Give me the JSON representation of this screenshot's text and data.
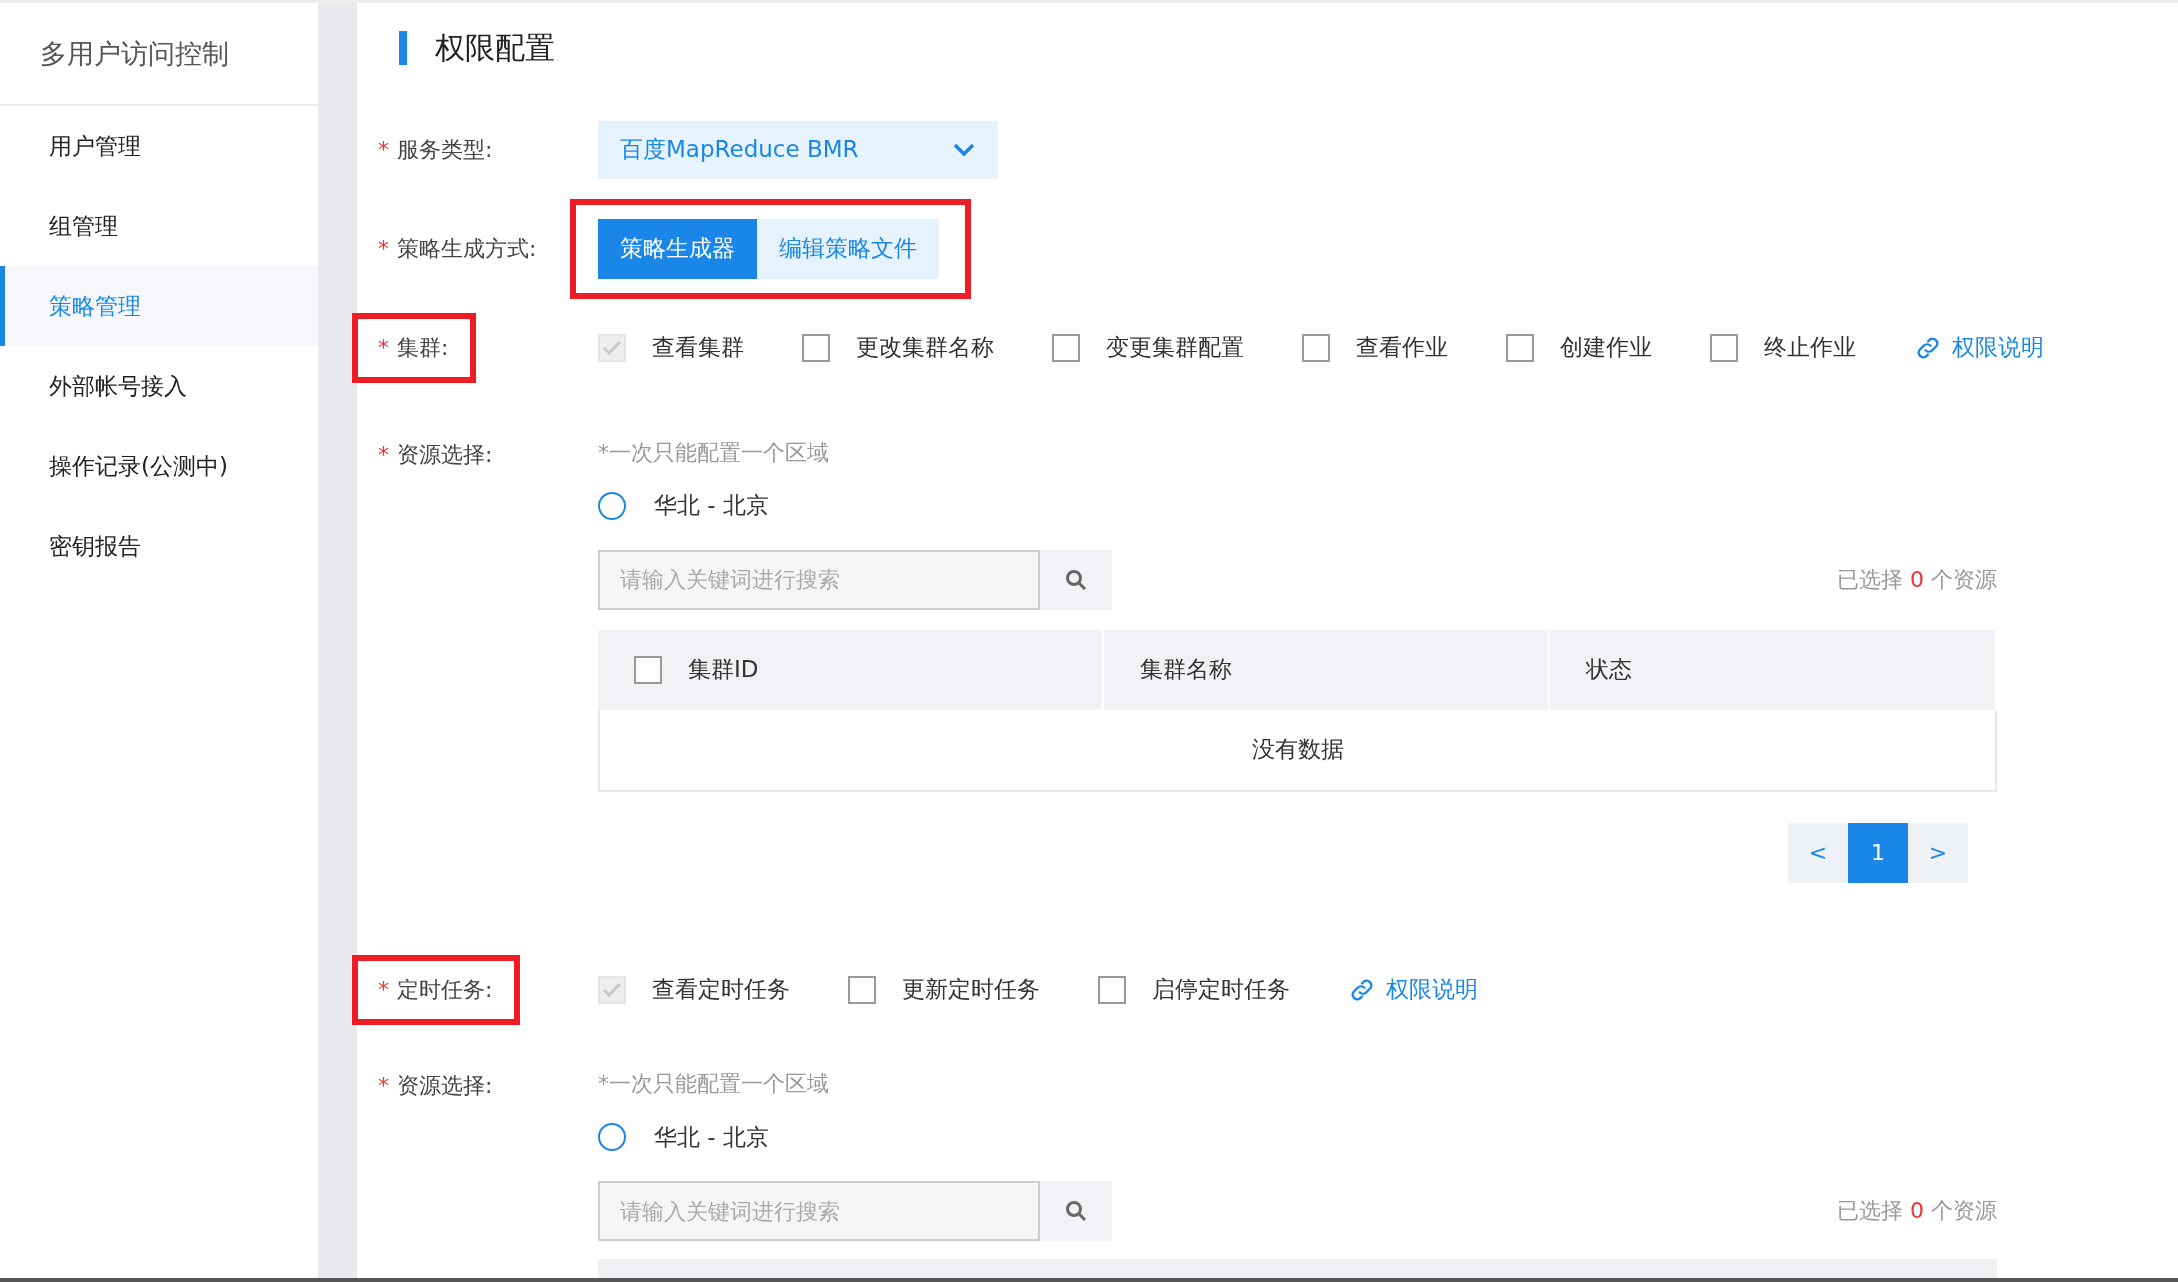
{
  "sidebar": {
    "title": "多用户访问控制",
    "items": [
      {
        "label": "用户管理",
        "selected": false
      },
      {
        "label": "组管理",
        "selected": false
      },
      {
        "label": "策略管理",
        "selected": true
      },
      {
        "label": "外部帐号接入",
        "selected": false
      },
      {
        "label": "操作记录(公测中)",
        "selected": false
      },
      {
        "label": "密钥报告",
        "selected": false
      }
    ]
  },
  "page_title": "权限配置",
  "service_type": {
    "label": "服务类型:",
    "required_mark": "*",
    "value": "百度MapReduce BMR"
  },
  "policy_mode": {
    "label": "策略生成方式:",
    "required_mark": "*",
    "highlighted": true,
    "options": [
      {
        "label": "策略生成器",
        "selected": true
      },
      {
        "label": "编辑策略文件",
        "selected": false
      }
    ]
  },
  "sections": [
    {
      "label": "集群:",
      "required_mark": "*",
      "highlighted": true,
      "permissions": [
        {
          "label": "查看集群",
          "checked": true,
          "disabled": true
        },
        {
          "label": "更改集群名称",
          "checked": false,
          "disabled": false
        },
        {
          "label": "变更集群配置",
          "checked": false,
          "disabled": false
        },
        {
          "label": "查看作业",
          "checked": false,
          "disabled": false
        },
        {
          "label": "创建作业",
          "checked": false,
          "disabled": false
        },
        {
          "label": "终止作业",
          "checked": false,
          "disabled": false
        }
      ],
      "link": "权限说明",
      "resource": {
        "label": "资源选择:",
        "required_mark": "*",
        "hint": "*一次只能配置一个区域",
        "region": {
          "label": "华北 - 北京",
          "selected": false
        },
        "search": {
          "placeholder": "请输入关键词进行搜索"
        },
        "count_prefix": "已选择",
        "count": "0",
        "count_suffix": "个资源",
        "table": {
          "columns": [
            "集群ID",
            "集群名称",
            "状态"
          ],
          "empty_text": "没有数据",
          "select_all": false
        },
        "pagination": {
          "prev": "<",
          "next": ">",
          "pages": [
            {
              "label": "1",
              "selected": true
            }
          ]
        }
      }
    },
    {
      "label": "定时任务:",
      "required_mark": "*",
      "highlighted": true,
      "permissions": [
        {
          "label": "查看定时任务",
          "checked": true,
          "disabled": true
        },
        {
          "label": "更新定时任务",
          "checked": false,
          "disabled": false
        },
        {
          "label": "启停定时任务",
          "checked": false,
          "disabled": false
        }
      ],
      "link": "权限说明",
      "resource": {
        "label": "资源选择:",
        "required_mark": "*",
        "hint": "*一次只能配置一个区域",
        "region": {
          "label": "华北 - 北京",
          "selected": false
        },
        "search": {
          "placeholder": "请输入关键词进行搜索"
        },
        "count_prefix": "已选择",
        "count": "0",
        "count_suffix": "个资源",
        "table": {
          "cut": true
        }
      }
    }
  ]
}
